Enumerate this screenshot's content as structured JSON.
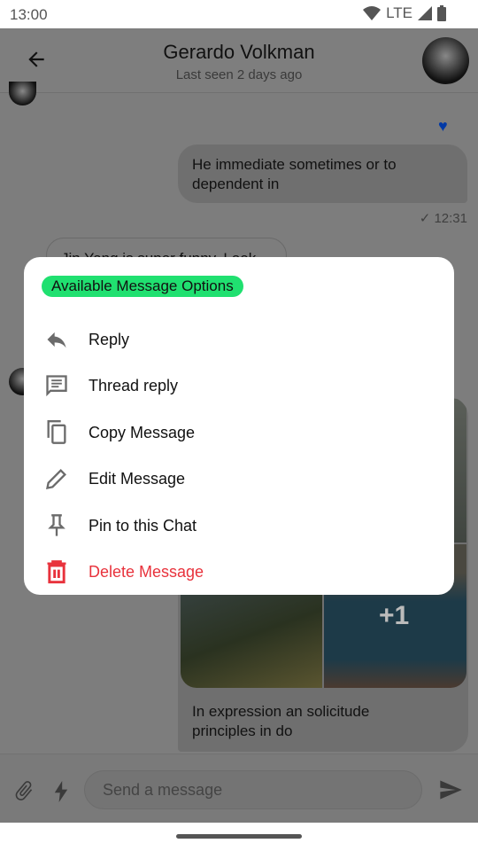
{
  "status_bar": {
    "time": "13:00",
    "network": "LTE"
  },
  "header": {
    "title": "Gerardo Volkman",
    "subtitle": "Last seen 2 days ago"
  },
  "messages": [
    {
      "text": "He immediate sometimes or to dependent in",
      "time": "12:31",
      "reaction": "heart"
    },
    {
      "text": "Jin Yang is super funny. Look"
    },
    {
      "caption": "In expression an solicitude principles in do",
      "more_count": "+1"
    }
  ],
  "dialog": {
    "title": "Available Message Options",
    "options": [
      {
        "label": "Reply",
        "icon": "reply-icon"
      },
      {
        "label": "Thread reply",
        "icon": "thread-icon"
      },
      {
        "label": "Copy Message",
        "icon": "copy-icon"
      },
      {
        "label": "Edit Message",
        "icon": "edit-icon"
      },
      {
        "label": "Pin to this Chat",
        "icon": "pin-icon"
      },
      {
        "label": "Delete Message",
        "icon": "delete-icon"
      }
    ]
  },
  "composer": {
    "placeholder": "Send a message"
  },
  "colors": {
    "accent_chip": "#20e070",
    "danger": "#e8323c",
    "reaction": "#0039a6"
  }
}
